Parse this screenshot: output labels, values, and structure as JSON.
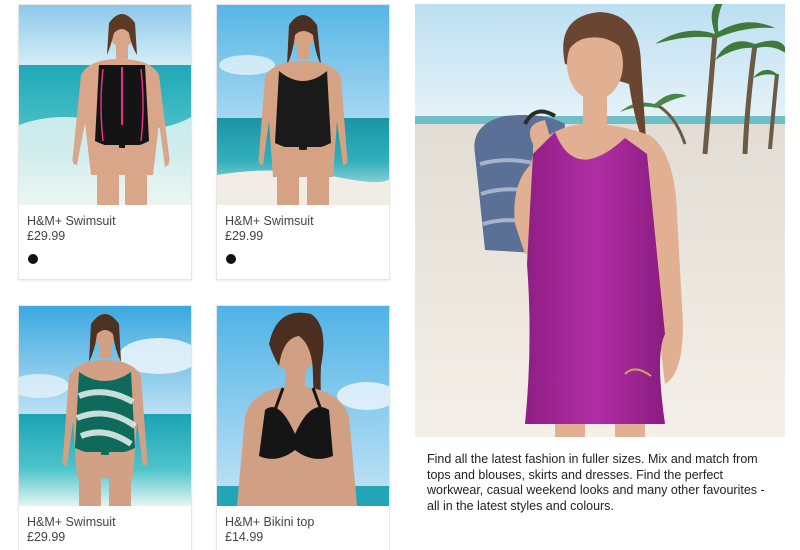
{
  "products": [
    {
      "name": "H&M+ Swimsuit",
      "price": "£29.99",
      "swatch": "#111111"
    },
    {
      "name": "H&M+ Swimsuit",
      "price": "£29.99",
      "swatch": "#111111"
    },
    {
      "name": "H&M+ Swimsuit",
      "price": "£29.99"
    },
    {
      "name": "H&M+ Bikini top",
      "price": "£14.99"
    }
  ],
  "promo": {
    "text": "Find all the latest fashion in fuller sizes. Mix and match from tops and blouses, skirts and dresses. Find the perfect workwear, casual weekend looks and many other favourites - all in the latest styles and colours."
  },
  "colors": {
    "sea": "#3fc0c7",
    "sky": "#a9d6ef",
    "dress": "#a6289b",
    "swimsuit_black": "#111111",
    "swimsuit_pink_trim": "#e0357f"
  }
}
